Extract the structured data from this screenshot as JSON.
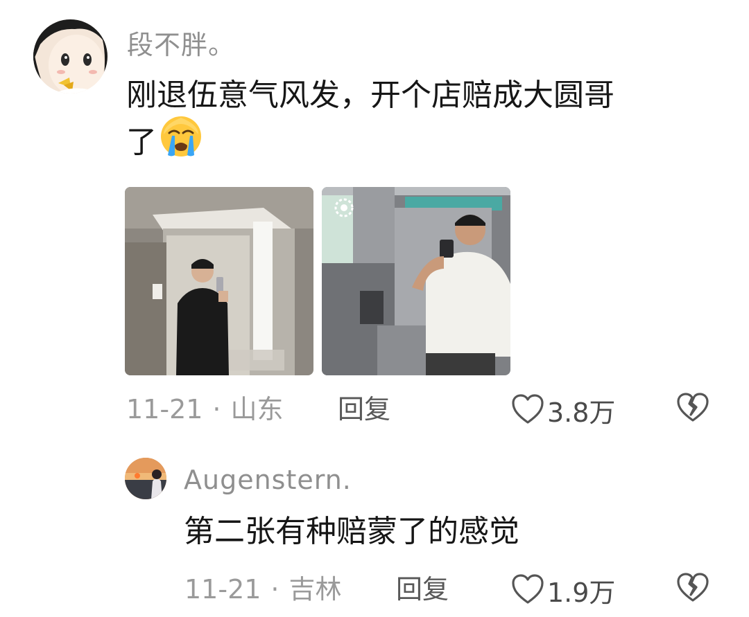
{
  "main_comment": {
    "username": "段不胖。",
    "text_line1": "刚退伍意气风发，开个店赔成大圆哥",
    "text_line2": "了",
    "emoji": "loudly-crying-face",
    "date": "11-21",
    "separator": "·",
    "location": "山东",
    "reply_label": "回复",
    "like_count": "3.8万"
  },
  "reply_comment": {
    "username": "Augenstern.",
    "text": "第二张有种赔蒙了的感觉",
    "date": "11-21",
    "separator": "·",
    "location": "吉林",
    "reply_label": "回复",
    "like_count": "1.9万"
  },
  "colors": {
    "meta_gray": "#9a9a9a",
    "username_gray": "#8f8f8f",
    "text": "#161616"
  }
}
